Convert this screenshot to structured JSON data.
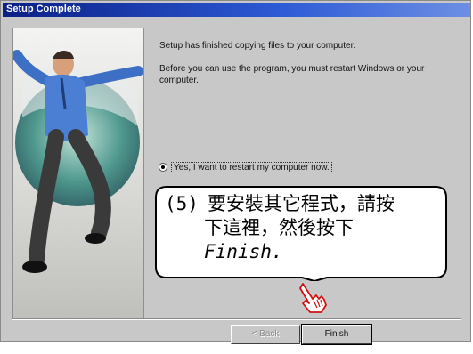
{
  "window": {
    "title": "Setup Complete"
  },
  "content": {
    "line1": "Setup has finished copying files to your computer.",
    "line2": "Before you can use the program, you must restart Windows or your computer."
  },
  "option": {
    "label": "Yes, I want to restart my computer now.",
    "selected": true
  },
  "callout": {
    "number": "(5)",
    "line1": "要安裝其它程式，請按",
    "line2": "下這裡，然後按下",
    "line3": "Finish."
  },
  "buttons": {
    "back": "< Back",
    "finish": "Finish"
  },
  "icons": {
    "pointer": "hand-pointer-icon",
    "radio": "radio-icon"
  }
}
